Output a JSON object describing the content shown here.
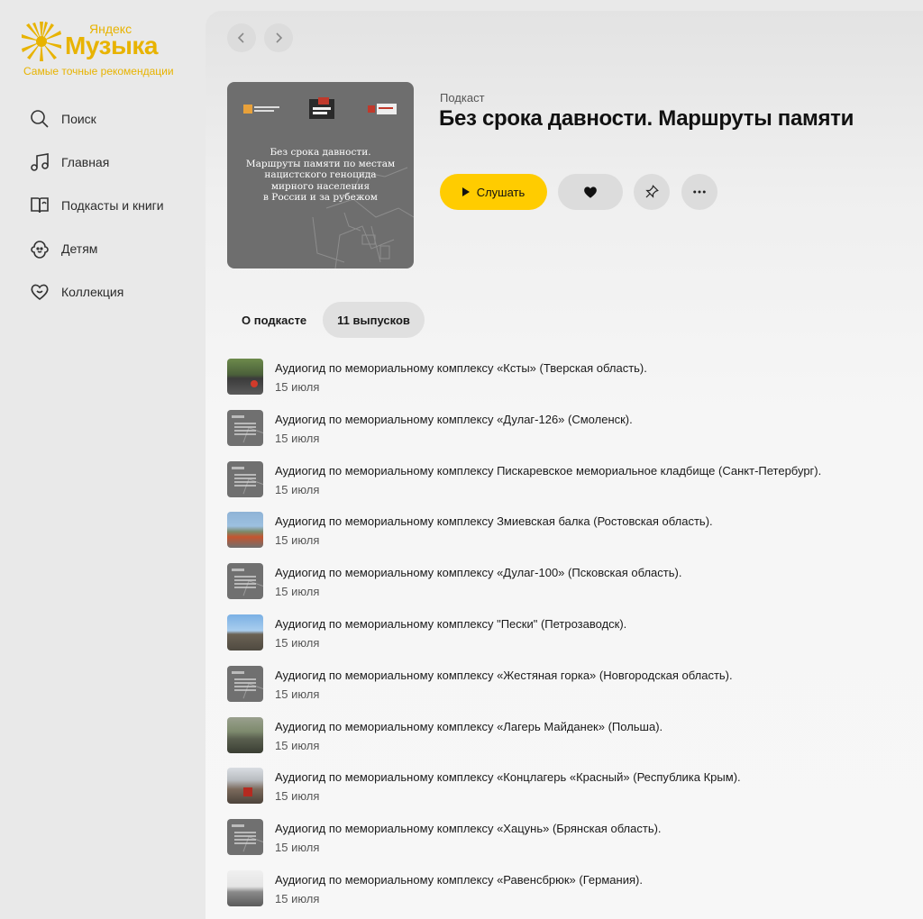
{
  "colors": {
    "accent": "#ffcc00",
    "brand": "#e8b300"
  },
  "logo": {
    "brand_small": "Яндекс",
    "brand_big": "Музыка",
    "tagline": "Самые точные рекомендации"
  },
  "sidebar": {
    "items": [
      {
        "label": "Поиск",
        "icon": "search-icon"
      },
      {
        "label": "Главная",
        "icon": "music-note-icon"
      },
      {
        "label": "Подкасты и книги",
        "icon": "book-icon"
      },
      {
        "label": "Детям",
        "icon": "kids-icon"
      },
      {
        "label": "Коллекция",
        "icon": "heart-icon"
      }
    ]
  },
  "header": {
    "type_label": "Подкаст",
    "title": "Без срока давности. Маршруты памяти",
    "listen_label": "Слушать"
  },
  "cover": {
    "text": "Без срока давности.\nМаршруты памяти по местам\nнацистского геноцида\nмирного населения\nв России и за рубежом"
  },
  "tabs": [
    {
      "label": "О подкасте",
      "active": false
    },
    {
      "label": "11 выпусков",
      "active": true
    }
  ],
  "episodes": [
    {
      "title": "Аудиогид по мемориальному комплексу «Ксты» (Тверская область).",
      "date": "15 июля"
    },
    {
      "title": "Аудиогид по мемориальному комплексу «Дулаг-126» (Смоленск).",
      "date": "15 июля"
    },
    {
      "title": "Аудиогид по мемориальному комплексу Пискаревское мемориальное кладбище (Санкт-Петербург).",
      "date": "15 июля"
    },
    {
      "title": "Аудиогид по мемориальному комплексу Змиевская балка (Ростовская область).",
      "date": "15 июля"
    },
    {
      "title": "Аудиогид по мемориальному комплексу «Дулаг-100» (Псковская область).",
      "date": "15 июля"
    },
    {
      "title": "Аудиогид по мемориальному комплексу \"Пески\" (Петрозаводск).",
      "date": "15 июля"
    },
    {
      "title": "Аудиогид по мемориальному комплексу «Жестяная горка» (Новгородская область).",
      "date": "15 июля"
    },
    {
      "title": "Аудиогид по мемориальному комплексу «Лагерь Майданек» (Польша).",
      "date": "15 июля"
    },
    {
      "title": "Аудиогид по мемориальному комплексу «Концлагерь «Красный» (Республика Крым).",
      "date": "15 июля"
    },
    {
      "title": "Аудиогид по мемориальному комплексу «Хацунь» (Брянская область).",
      "date": "15 июля"
    },
    {
      "title": "Аудиогид по мемориальному комплексу «Равенсбрюк» (Германия).",
      "date": "15 июля"
    }
  ]
}
